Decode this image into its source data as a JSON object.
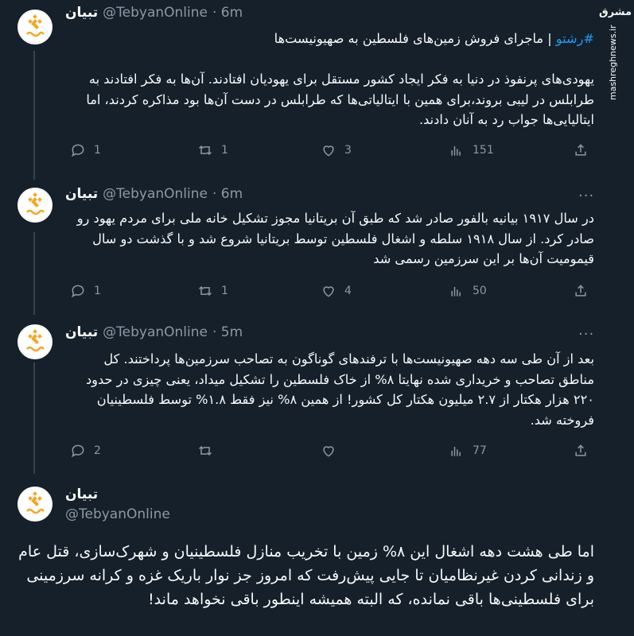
{
  "watermark": {
    "logo_text": "مشرق",
    "site": "mashreghnews.ir"
  },
  "tweets": [
    {
      "name": "تبیان",
      "handle": "@TebyanOnline",
      "time": "· 6m",
      "hashtag": "#رشتو",
      "text_after_hashtag": " | ماجرای فروش زمین‌های فلسطین به صهیونیست‌ها\n\nیهودی‌های پرنفوذ در دنیا به فکر ایجاد کشور مستقل برای یهودیان افتادند. آن‌ها به فکر افتادند به طرابلس در لیبی بروند،برای همین با ایتالیاتی‌ها که طرابلس در دست آن‌ها بود مذاکره کردند، اما ایتالیایی‌ها جواب رد به آنان دادند.",
      "replies": "1",
      "retweets": "1",
      "likes": "3",
      "views": "151"
    },
    {
      "name": "تبیان",
      "handle": "@TebyanOnline",
      "time": "· 6m",
      "text": "در سال ۱۹۱۷ بیانیه بالفور صادر شد که طبق آن بریتانیا مجوز تشکیل خانه ملی برای مردم یهود رو صادر کرد. از سال ۱۹۱۸ سلطه و اشغال فلسطین توسط بریتانیا شروع شد و با گذشت دو سال قیمومیت آن‌ها بر این سرزمین رسمی شد",
      "replies": "1",
      "retweets": "1",
      "likes": "4",
      "views": "50"
    },
    {
      "name": "تبیان",
      "handle": "@TebyanOnline",
      "time": "· 5m",
      "text": "بعد از آن طی سه دهه صهیونیست‌ها با ترفندهای گوناگون به تصاحب سرزمین‌ها پرداختند. کل مناطق تصاحب و خریداری شده نهایتا ۸% از خاک فلسطین را تشکیل میداد، یعنی چیزی در حدود ۲۲۰ هزار هکتار از ۲.۷ میلیون هکتار کل کشور! از همین ۸% نیز فقط ۱.۸% توسط فلسطینیان فروخته شد.",
      "replies": "2",
      "retweets": "",
      "likes": "",
      "views": "77"
    }
  ],
  "main_tweet": {
    "name": "تبیان",
    "handle": "@TebyanOnline",
    "text": "اما طی هشت دهه اشغال این ۸% زمین با تخریب منازل فلسطینیان و شهرک‌سازی، قتل عام و زندانی کردن غیرنظامیان تا جایی پیش‌رفت که امروز جز نوار باریک غزه و کرانه سرزمینی برای فلسطینی‌ها باقی نمانده، که البته همیشه اینطور باقی نخواهد ماند!"
  },
  "icons": {
    "reply": "reply-icon",
    "retweet": "retweet-icon",
    "like": "heart-icon",
    "views": "views-icon",
    "share": "share-icon",
    "more": "more-icon"
  },
  "colors": {
    "background": "#15202b",
    "text": "#f7f9f9",
    "secondary": "#8b98a5",
    "hashtag": "#1d9bf0",
    "avatar_brand": "#f5a623"
  }
}
